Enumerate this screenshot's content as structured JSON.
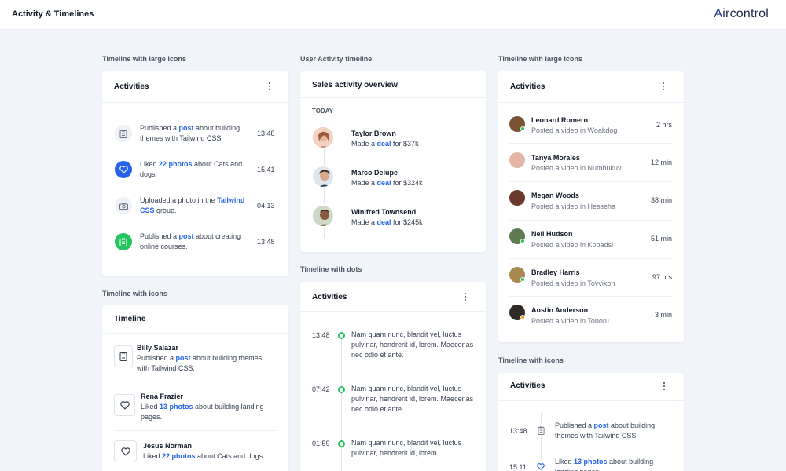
{
  "header": {
    "title": "Activity & Timelines",
    "brand": "ircontrol",
    "brand_mark": "A"
  },
  "sections": {
    "s1": "Timeline with large icons",
    "s2": "User Activity timeline",
    "s3": "Timeline with large icons",
    "s4": "Timeline with icons",
    "s5": "Timeline with dots",
    "s6": "Timeline with icons"
  },
  "card1": {
    "title": "Activities",
    "items": [
      {
        "pre": "Published a ",
        "link": "post",
        "post": " about building themes with Tailwind CSS.",
        "time": "13:48",
        "icon": "clipboard-icon"
      },
      {
        "pre": "Liked ",
        "link": "22 photos",
        "post": " about Cats and dogs.",
        "time": "15:41",
        "icon": "heart-icon"
      },
      {
        "pre": "Uploaded a photo in the ",
        "link": "Tailwind CSS",
        "post": " group.",
        "time": "04:13",
        "icon": "camera-icon"
      },
      {
        "pre": "Published a ",
        "link": "post",
        "post": " about creating online courses.",
        "time": "13:48",
        "icon": "clipboard-icon"
      }
    ]
  },
  "card2": {
    "title": "Sales activity overview",
    "today": "TODAY",
    "items": [
      {
        "name": "Taylor Brown",
        "pre": "Made a ",
        "link": "deal",
        "post": " for $37k"
      },
      {
        "name": "Marco Delupe",
        "pre": "Made a ",
        "link": "deal",
        "post": " for $324k"
      },
      {
        "name": "Winifred Townsend",
        "pre": "Made a ",
        "link": "deal",
        "post": " for $245k"
      }
    ]
  },
  "card3": {
    "title": "Activities",
    "items": [
      {
        "name": "Leonard Romero",
        "sub": "Posted a video in Woakdog",
        "time": "2 hrs",
        "status": "#22c55e"
      },
      {
        "name": "Tanya Morales",
        "sub": "Posted a video in Numbukuv",
        "time": "12 min",
        "status": ""
      },
      {
        "name": "Megan Woods",
        "sub": "Posted a video in Hesseha",
        "time": "38 min",
        "status": ""
      },
      {
        "name": "Neil Hudson",
        "sub": "Posted a video in Kobadsi",
        "time": "51 min",
        "status": "#22c55e"
      },
      {
        "name": "Bradley Harris",
        "sub": "Posted a video in Tovvikon",
        "time": "97 hrs",
        "status": "#22c55e"
      },
      {
        "name": "Austin Anderson",
        "sub": "Posted a video in Tonoru",
        "time": "3 min",
        "status": "#f59e0b"
      }
    ]
  },
  "card4": {
    "title": "Timeline",
    "items": [
      {
        "name": "Billy Salazar",
        "pre": "Published a ",
        "link": "post",
        "post": " about building themes with Tailwind CSS."
      },
      {
        "name": "Rena Frazier",
        "pre": "Liked ",
        "link": "13 photos",
        "post": " about building landing pages."
      },
      {
        "name": "Jesus Norman",
        "pre": "Liked ",
        "link": "22 photos",
        "post": " about Cats and dogs."
      }
    ]
  },
  "card5": {
    "title": "Activities",
    "items": [
      {
        "time": "13:48",
        "text": "Nam quam nunc, blandit vel, luctus pulvinar, hendrerit id, lorem. Maecenas nec odio et ante."
      },
      {
        "time": "07:42",
        "text": "Nam quam nunc, blandit vel, luctus pulvinar, hendrerit id, lorem. Maecenas nec odio et ante."
      },
      {
        "time": "01:59",
        "text": "Nam quam nunc, blandit vel, luctus pulvinar, hendrerit id, lorem."
      }
    ]
  },
  "card6": {
    "title": "Activities",
    "items": [
      {
        "time": "13:48",
        "pre": "Published a ",
        "link": "post",
        "post": " about building themes with Tailwind CSS."
      },
      {
        "time": "15:11",
        "pre": "Liked ",
        "link": "13 photos",
        "post": " about building landing pages."
      }
    ]
  },
  "colors": {
    "accent": "#2563eb",
    "success": "#22c55e",
    "warning": "#f59e0b"
  }
}
